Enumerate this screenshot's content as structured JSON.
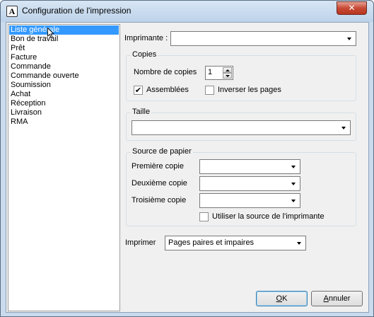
{
  "window": {
    "title": "Configuration de l'impression",
    "app_icon_letter": "A",
    "close_glyph": "✕"
  },
  "report_list": {
    "selected_index": 0,
    "items": [
      "Liste générale",
      "Bon de travail",
      "Prêt",
      "Facture",
      "Commande",
      "Commande ouverte",
      "Soumission",
      "Achat",
      "Réception",
      "Livraison",
      "RMA"
    ]
  },
  "printer": {
    "label": "Imprimante :",
    "value": ""
  },
  "copies": {
    "title": "Copies",
    "count_label": "Nombre de copies",
    "count_value": "1",
    "collate_label": "Assemblées",
    "collate_checked": true,
    "reverse_label": "Inverser les pages",
    "reverse_checked": false
  },
  "size": {
    "title": "Taille",
    "value": ""
  },
  "paper_source": {
    "title": "Source de papier",
    "first_label": "Première copie",
    "first_value": "",
    "second_label": "Deuxième copie",
    "second_value": "",
    "third_label": "Troisième copie",
    "third_value": "",
    "use_printer_source_label": "Utiliser la source de l'imprimante",
    "use_printer_source_checked": false
  },
  "print_pages": {
    "label": "Imprimer",
    "value": "Pages paires et impaires"
  },
  "buttons": {
    "ok": "OK",
    "cancel": "Annuler"
  },
  "check_glyph": "✔"
}
